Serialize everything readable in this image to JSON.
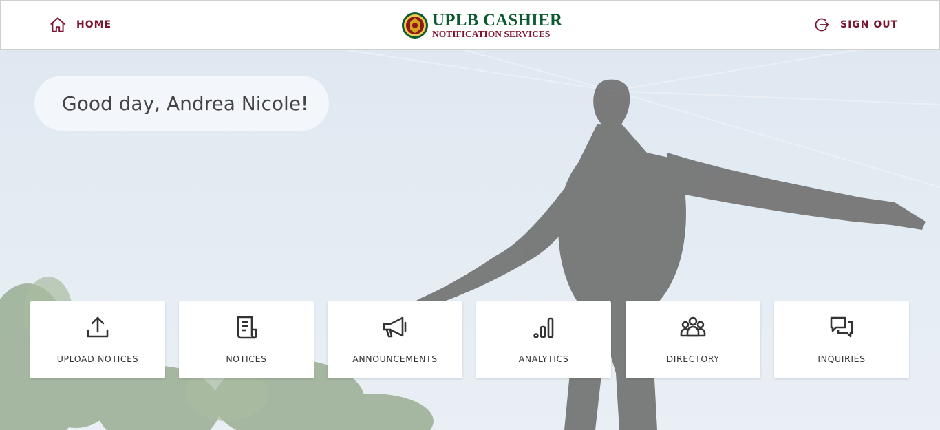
{
  "header": {
    "home_label": "HOME",
    "signout_label": "SIGN OUT",
    "brand_title": "UPLB CASHIER",
    "brand_subtitle": "NOTIFICATION SERVICES"
  },
  "greeting": "Good day, Andrea Nicole!",
  "cards": [
    {
      "label": "UPLOAD NOTICES",
      "icon": "upload-icon"
    },
    {
      "label": "NOTICES",
      "icon": "document-icon"
    },
    {
      "label": "ANNOUNCEMENTS",
      "icon": "megaphone-icon"
    },
    {
      "label": "ANALYTICS",
      "icon": "bar-chart-icon"
    },
    {
      "label": "DIRECTORY",
      "icon": "people-icon"
    },
    {
      "label": "INQUIRIES",
      "icon": "chat-icon"
    }
  ],
  "colors": {
    "brand_maroon": "#7b1430",
    "brand_green": "#0b5a30"
  }
}
